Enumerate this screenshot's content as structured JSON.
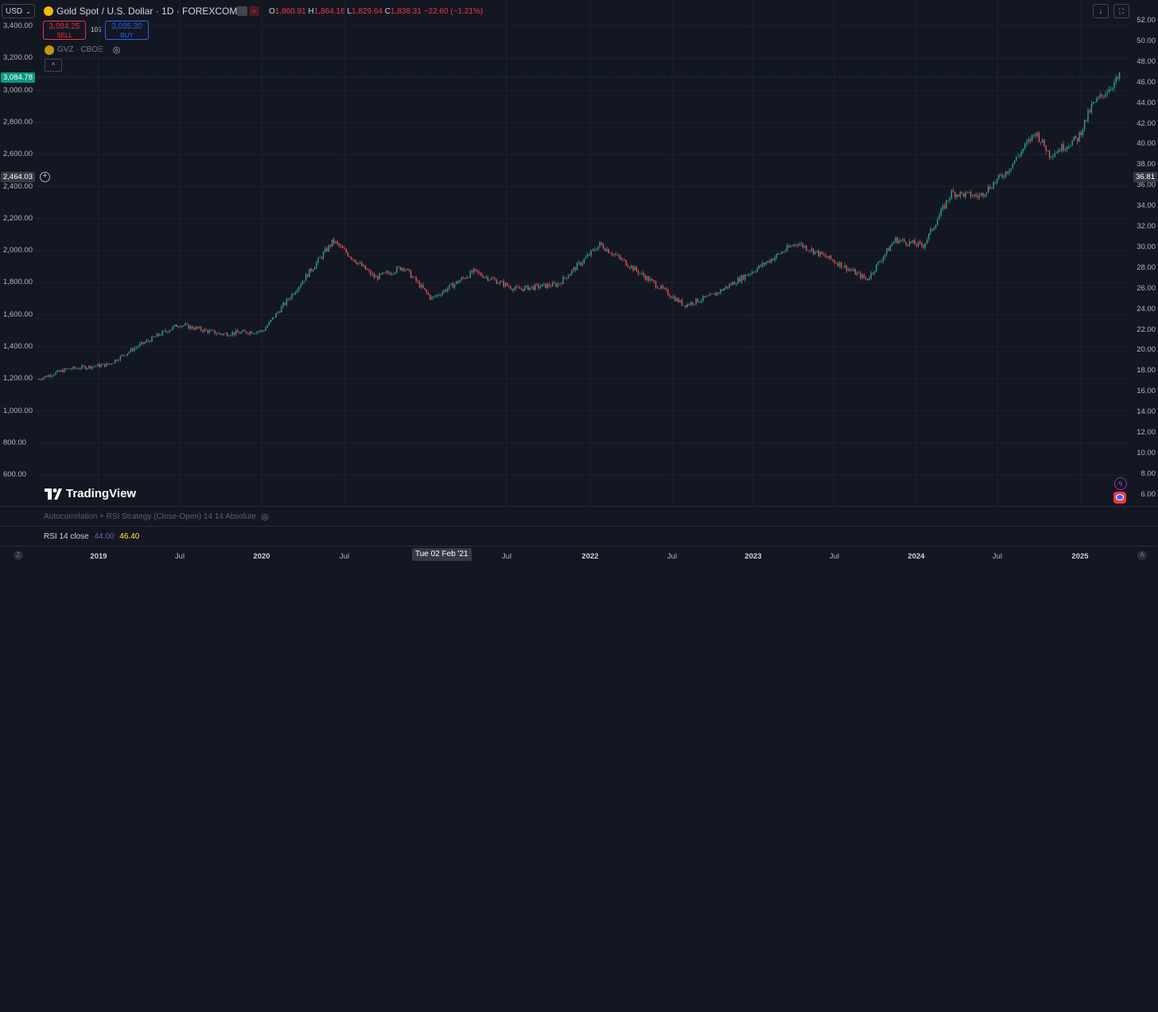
{
  "toolbar": {
    "currency": "USD",
    "symbol_title": "Gold Spot / U.S. Dollar · 1D · FOREXCOM",
    "ohlc": {
      "o_label": "O",
      "o": "1,860.91",
      "h_label": "H",
      "h": "1,864.16",
      "l_label": "L",
      "l": "1,829.64",
      "c_label": "C",
      "c": "1,838.31",
      "chg": "−22.60 (−1.21%)"
    },
    "sell_price": "3,084.25",
    "sell_label": "SELL",
    "spread": "105",
    "buy_price": "3,085.30",
    "buy_label": "BUY",
    "overlay_name": "GVZ · CBOE"
  },
  "left_axis": {
    "ticks": [
      "3,400.00",
      "3,200.00",
      "3,000.00",
      "2,800.00",
      "2,600.00",
      "2,400.00",
      "2,200.00",
      "2,000.00",
      "1,800.00",
      "1,600.00",
      "1,400.00",
      "1,200.00",
      "1,000.00",
      "800.00",
      "600.00"
    ],
    "last_price": "3,084.78",
    "crosshair_price": "2,464.03"
  },
  "right_axis": {
    "ticks": [
      "52.00",
      "50.00",
      "48.00",
      "46.00",
      "44.00",
      "42.00",
      "40.00",
      "38.00",
      "36.00",
      "34.00",
      "32.00",
      "30.00",
      "28.00",
      "26.00",
      "24.00",
      "22.00",
      "20.00",
      "18.00",
      "16.00",
      "14.00",
      "12.00",
      "10.00",
      "8.00",
      "6.00"
    ],
    "crosshair_value": "36.81"
  },
  "logo": "TradingView",
  "indicators": {
    "strategy": "Autocorrelation + RSI Strategy (Close-Open) 14 14 Absolute",
    "rsi_label": "RSI 14 close",
    "rsi_value1": "44.00",
    "rsi_value2": "46.40"
  },
  "time_axis": {
    "z_button": "Z",
    "a_button": "A",
    "ticks": [
      {
        "label": "2019",
        "year": true
      },
      {
        "label": "Jul",
        "year": false
      },
      {
        "label": "2020",
        "year": true
      },
      {
        "label": "Jul",
        "year": false
      },
      {
        "label": "Jul",
        "year": false
      },
      {
        "label": "2022",
        "year": true
      },
      {
        "label": "Jul",
        "year": false
      },
      {
        "label": "2023",
        "year": true
      },
      {
        "label": "Jul",
        "year": false
      },
      {
        "label": "2024",
        "year": true
      },
      {
        "label": "Jul",
        "year": false
      },
      {
        "label": "2025",
        "year": true
      }
    ],
    "crosshair_date": "Tue 02 Feb '21"
  },
  "colors": {
    "background": "#131722",
    "up": "#26a69a",
    "down": "#ef5350",
    "grid": "#1e2230",
    "accent_blue": "#2962ff",
    "accent_red": "#f23645",
    "last_price_bg": "#089981"
  },
  "chart_data": {
    "type": "candlestick",
    "title": "Gold Spot / U.S. Dollar · 1D · FOREXCOM",
    "y_axis_left": {
      "min": 500,
      "max": 3500
    },
    "y_axis_right_label_range": [
      6,
      52
    ],
    "x_range": [
      "2018-11",
      "2025-04"
    ],
    "series_close_approx": [
      {
        "x": "2018-11",
        "y": 1200
      },
      {
        "x": "2019-01",
        "y": 1260
      },
      {
        "x": "2019-04",
        "y": 1290
      },
      {
        "x": "2019-06",
        "y": 1400
      },
      {
        "x": "2019-09",
        "y": 1540
      },
      {
        "x": "2019-12",
        "y": 1480
      },
      {
        "x": "2020-03",
        "y": 1500
      },
      {
        "x": "2020-05",
        "y": 1720
      },
      {
        "x": "2020-08",
        "y": 2060
      },
      {
        "x": "2020-11",
        "y": 1830
      },
      {
        "x": "2021-01",
        "y": 1900
      },
      {
        "x": "2021-03",
        "y": 1700
      },
      {
        "x": "2021-06",
        "y": 1870
      },
      {
        "x": "2021-09",
        "y": 1760
      },
      {
        "x": "2021-12",
        "y": 1790
      },
      {
        "x": "2022-03",
        "y": 2040
      },
      {
        "x": "2022-06",
        "y": 1850
      },
      {
        "x": "2022-09",
        "y": 1660
      },
      {
        "x": "2022-11",
        "y": 1720
      },
      {
        "x": "2023-02",
        "y": 1880
      },
      {
        "x": "2023-05",
        "y": 2050
      },
      {
        "x": "2023-08",
        "y": 1920
      },
      {
        "x": "2023-10",
        "y": 1820
      },
      {
        "x": "2023-12",
        "y": 2070
      },
      {
        "x": "2024-02",
        "y": 2030
      },
      {
        "x": "2024-04",
        "y": 2360
      },
      {
        "x": "2024-06",
        "y": 2340
      },
      {
        "x": "2024-08",
        "y": 2500
      },
      {
        "x": "2024-10",
        "y": 2740
      },
      {
        "x": "2024-11",
        "y": 2600
      },
      {
        "x": "2025-01",
        "y": 2700
      },
      {
        "x": "2025-02",
        "y": 2900
      },
      {
        "x": "2025-04",
        "y": 3085
      }
    ]
  }
}
